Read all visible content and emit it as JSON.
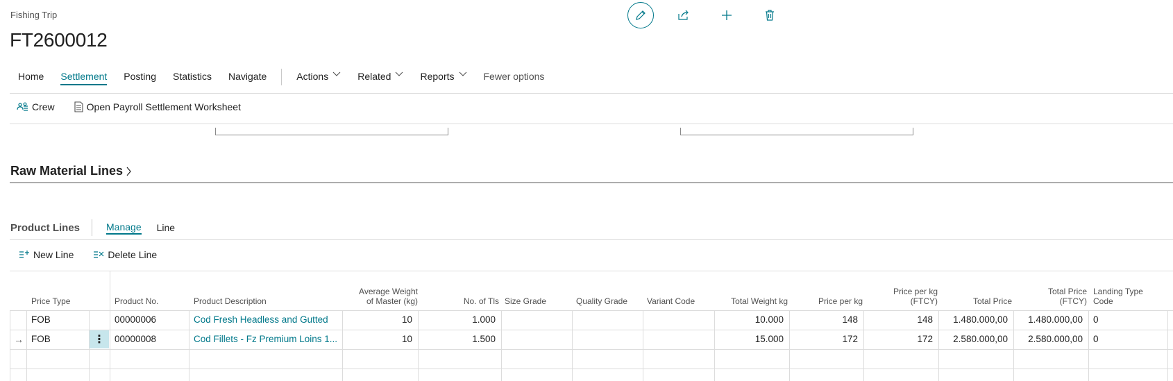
{
  "header": {
    "caption": "Fishing Trip",
    "title": "FT2600012"
  },
  "top_actions": {
    "icons": [
      "edit-icon",
      "share-icon",
      "new-icon",
      "delete-icon"
    ]
  },
  "menu": {
    "items": [
      "Home",
      "Settlement",
      "Posting",
      "Statistics",
      "Navigate"
    ],
    "active": "Settlement",
    "groups": [
      "Actions",
      "Related",
      "Reports"
    ],
    "fewer_options": "Fewer options"
  },
  "settlement_actions": {
    "crew": "Crew",
    "open_worksheet": "Open Payroll Settlement Worksheet"
  },
  "raw_material": {
    "title": "Raw Material Lines"
  },
  "product_lines": {
    "title": "Product Lines",
    "tabs": [
      "Manage",
      "Line"
    ],
    "active_tab": "Manage",
    "new_line": "New Line",
    "delete_line": "Delete Line",
    "columns": {
      "price_type": "Price Type",
      "product_no": "Product No.",
      "product_description": "Product Description",
      "avg_weight_1": "Average Weight",
      "avg_weight_2": "of Master (kg)",
      "no_of_tls": "No. of Tls",
      "size_grade": "Size Grade",
      "quality_grade": "Quality Grade",
      "variant_code": "Variant Code",
      "total_weight": "Total Weight kg",
      "price_per_kg": "Price per kg",
      "price_per_kg_ftcy_1": "Price per kg",
      "price_per_kg_ftcy_2": "(FTCY)",
      "total_price": "Total Price",
      "total_price_ftcy_1": "Total Price",
      "total_price_ftcy_2": "(FTCY)",
      "landing_type_1": "Landing Type",
      "landing_type_2": "Code"
    },
    "rows": [
      {
        "price_type": "FOB",
        "product_no": "00000006",
        "product_description": "Cod Fresh Headless and Gutted",
        "avg_weight": "10",
        "no_of_tls": "1.000",
        "size_grade": "",
        "quality_grade": "",
        "variant_code": "",
        "total_weight": "10.000",
        "price_per_kg": "148",
        "price_per_kg_ftcy": "148",
        "total_price": "1.480.000,00",
        "total_price_ftcy": "1.480.000,00",
        "landing_type": "0"
      },
      {
        "price_type": "FOB",
        "product_no": "00000008",
        "product_description": "Cod Fillets - Fz Premium Loins 1...",
        "avg_weight": "10",
        "no_of_tls": "1.500",
        "size_grade": "",
        "quality_grade": "",
        "variant_code": "",
        "total_weight": "15.000",
        "price_per_kg": "172",
        "price_per_kg_ftcy": "172",
        "total_price": "2.580.000,00",
        "total_price_ftcy": "2.580.000,00",
        "landing_type": "0",
        "current": true
      }
    ],
    "row_menu_glyph": "⋮",
    "current_row_glyph": "→"
  },
  "colors": {
    "accent": "#00788a",
    "text": "#212121",
    "muted_text": "#505050",
    "grid_line": "#dcdcdc",
    "row_selected": "#c7e6ec"
  }
}
